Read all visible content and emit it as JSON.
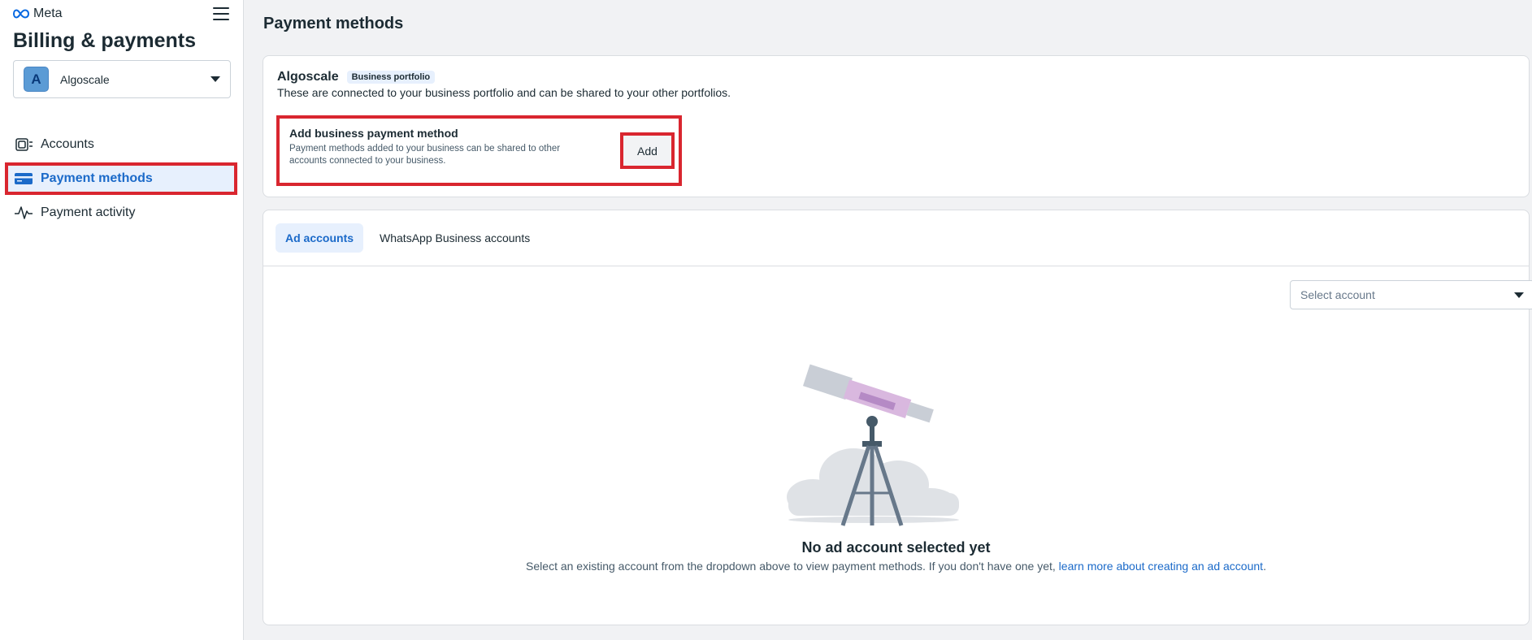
{
  "brand": {
    "name": "Meta"
  },
  "sidebar": {
    "title": "Billing & payments",
    "portfolio": {
      "avatar_letter": "A",
      "name": "Algoscale"
    },
    "items": [
      {
        "label": "Accounts",
        "icon": "accounts-icon"
      },
      {
        "label": "Payment methods",
        "icon": "credit-card-icon",
        "active": true
      },
      {
        "label": "Payment activity",
        "icon": "activity-pulse-icon"
      }
    ]
  },
  "main": {
    "title": "Payment methods",
    "business": {
      "name": "Algoscale",
      "badge": "Business portfolio",
      "description": "These are connected to your business portfolio and can be shared to your other portfolios.",
      "add_title": "Add business payment method",
      "add_description": "Payment methods added to your business can be shared to other accounts connected to your business.",
      "add_button": "Add"
    },
    "tabs": [
      {
        "label": "Ad accounts",
        "active": true
      },
      {
        "label": "WhatsApp Business accounts"
      }
    ],
    "select_account_placeholder": "Select account",
    "empty": {
      "title": "No ad account selected yet",
      "description": "Select an existing account from the dropdown above to view payment methods. If you don't have one yet, ",
      "link": "learn more about creating an ad account",
      "period": "."
    }
  },
  "colors": {
    "accent": "#1b6ac9",
    "highlight": "#d9262f"
  }
}
